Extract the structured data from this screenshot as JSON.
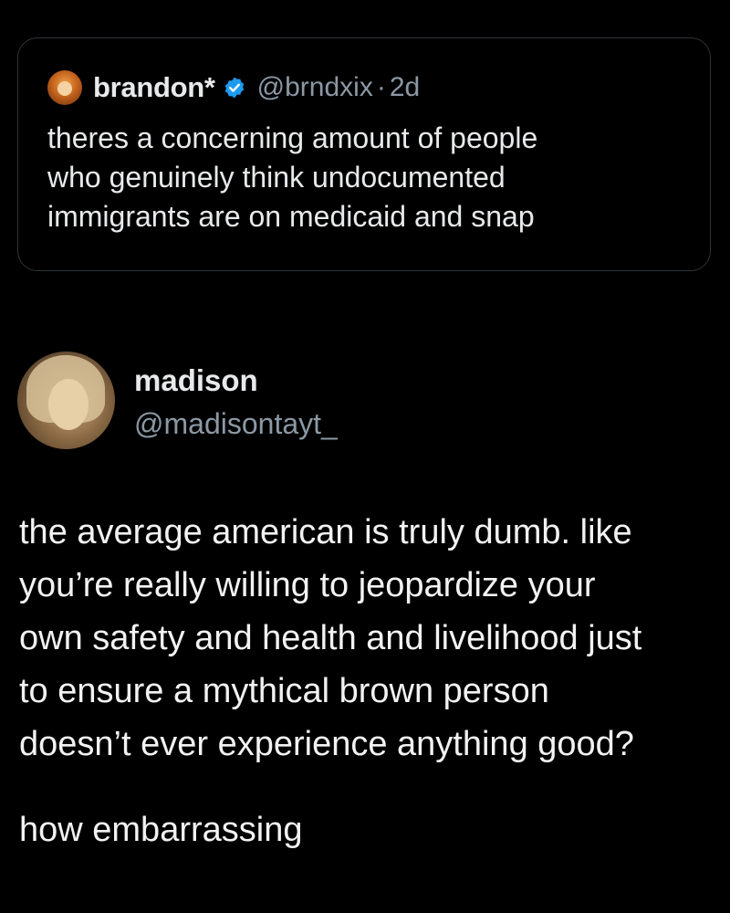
{
  "quoted_post": {
    "author_name": "brandon*",
    "verified": true,
    "handle": "@brndxix",
    "separator": "·",
    "time": "2d",
    "text_lines": [
      "theres a concerning amount of people",
      "who genuinely think undocumented",
      "immigrants are on medicaid and snap"
    ]
  },
  "post": {
    "author_name": "madison",
    "handle": "@madisontayt_",
    "text_lines": [
      "the average american is truly dumb. like",
      "you’re really willing to jeopardize your",
      "own safety and health and livelihood just",
      "to ensure a mythical brown person",
      "doesn’t ever experience anything good?"
    ],
    "closing": "how embarrassing"
  },
  "colors": {
    "background": "#000000",
    "card_border": "#2f3336",
    "primary_text": "#e7e9ea",
    "secondary_text": "#8b98a5",
    "verified_blue": "#1d9bf0"
  },
  "icons": {
    "verified": "verified-badge-icon"
  }
}
